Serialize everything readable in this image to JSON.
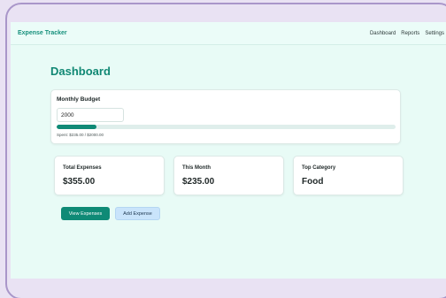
{
  "header": {
    "brand": "Expense Tracker",
    "nav": [
      "Dashboard",
      "Reports",
      "Settings"
    ]
  },
  "main": {
    "title": "Dashboard",
    "budget": {
      "title": "Monthly Budget",
      "input_value": "2000",
      "progress_fraction": 0.1175,
      "spent_text": "Spent: $235.00 / $2000.00"
    },
    "stats": [
      {
        "label": "Total Expenses",
        "value": "$355.00"
      },
      {
        "label": "This Month",
        "value": "$235.00"
      },
      {
        "label": "Top Category",
        "value": "Food"
      }
    ],
    "buttons": {
      "view": "View Expenses",
      "add": "Add Expense"
    }
  },
  "colors": {
    "accent": "#0f8a76",
    "app_background": "#e8fbf6",
    "frame_background": "#e9e2f3",
    "secondary_button": "#c9e4fb"
  }
}
